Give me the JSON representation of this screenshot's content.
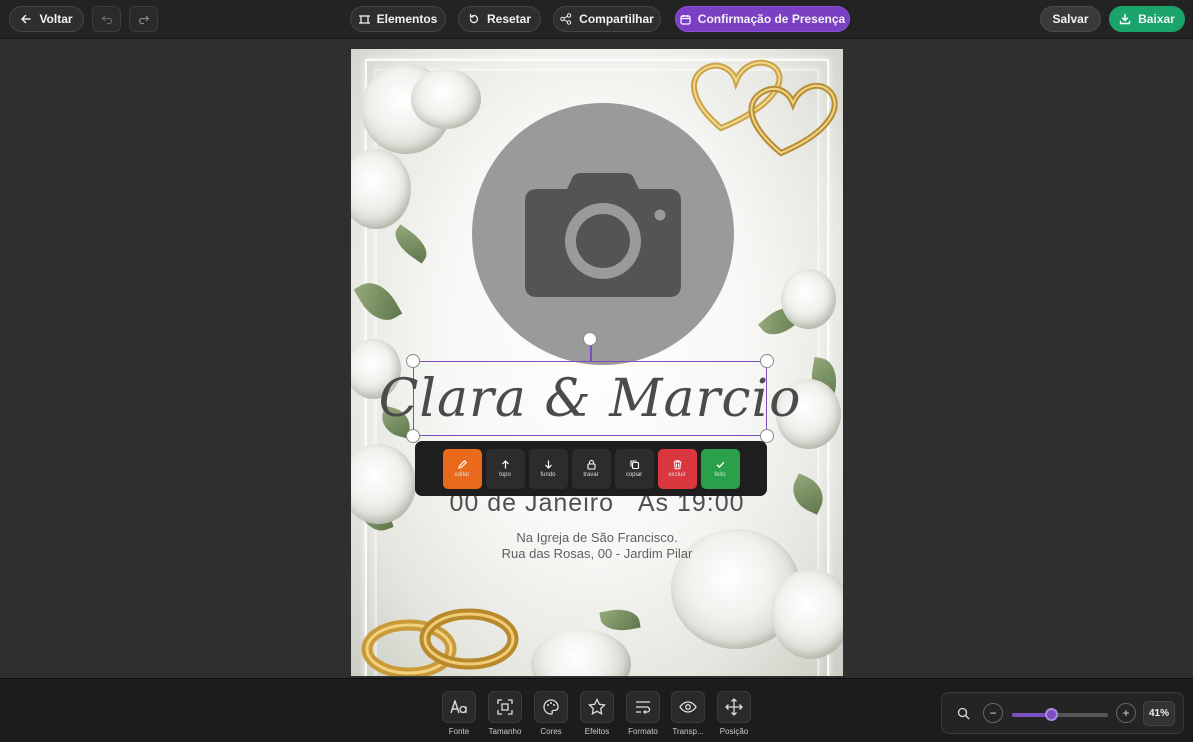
{
  "toolbar": {
    "back_label": "Voltar",
    "elements_label": "Elementos",
    "reset_label": "Resetar",
    "share_label": "Compartilhar",
    "rsvp_label": "Confirmação de Presença",
    "save_label": "Salvar",
    "download_label": "Baixar"
  },
  "invite": {
    "names": "Clara & Marcio",
    "date_line": "00 de Janeiro   Às 19:00",
    "address_line1": "Na Igreja de São Francisco.",
    "address_line2": "Rua das Rosas, 00 - Jardim Pilar"
  },
  "element_toolbar": {
    "edit": "editar",
    "top": "topo",
    "bottom": "fundo",
    "lock": "travar",
    "copy": "copiar",
    "delete": "excluir",
    "done": "feito"
  },
  "bottom_tools": {
    "font": "Fonte",
    "size": "Tamanho",
    "colors": "Cores",
    "effects": "Efeitos",
    "format": "Formato",
    "transparency": "Transp...",
    "position": "Posição"
  },
  "zoom": {
    "value_label": "41%",
    "level": 0.41
  },
  "colors": {
    "accent": "#7b3fc4",
    "download": "#1aa46b",
    "edit": "#e96a1a",
    "delete": "#d9363e",
    "done": "#2aa04a"
  }
}
